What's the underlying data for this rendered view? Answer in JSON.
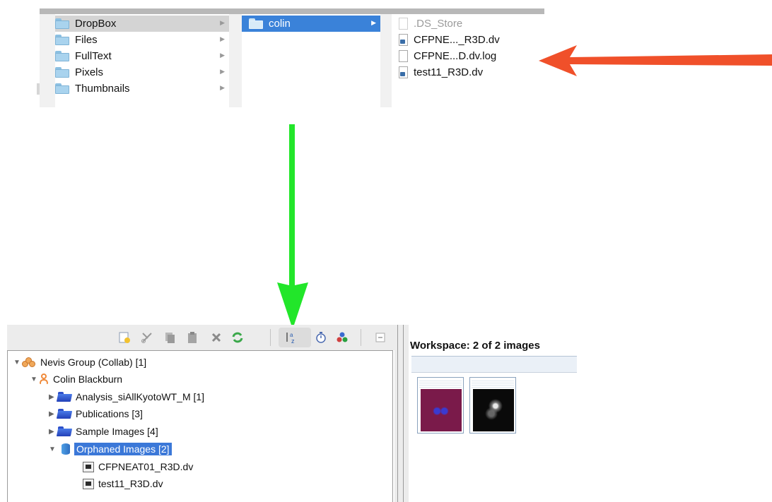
{
  "finder": {
    "column1": {
      "items": [
        {
          "label": "DropBox",
          "selected": true
        },
        {
          "label": "Files"
        },
        {
          "label": "FullText"
        },
        {
          "label": "Pixels"
        },
        {
          "label": "Thumbnails"
        }
      ]
    },
    "column2": {
      "items": [
        {
          "label": "colin",
          "selected": true
        }
      ]
    },
    "column3": {
      "items": [
        {
          "label": ".DS_Store",
          "icon": "blank-document-icon"
        },
        {
          "label": "CFPNE..._R3D.dv",
          "icon": "dv-document-icon"
        },
        {
          "label": "CFPNE...D.dv.log",
          "icon": "document-icon"
        },
        {
          "label": "test11_R3D.dv",
          "icon": "dv-document-icon"
        }
      ]
    }
  },
  "arrows": {
    "red": {
      "color": "#f0502a",
      "icon": "arrow-left"
    },
    "green": {
      "color": "#22e62a",
      "icon": "arrow-down"
    }
  },
  "toolbar": {
    "buttons": [
      "new-icon",
      "cut-icon",
      "copy-icon",
      "paste-icon",
      "delete-icon",
      "refresh-icon",
      "sort-alpha-icon",
      "sort-date-icon",
      "filter-icon",
      "collapse-icon"
    ],
    "active": "sort-alpha-icon"
  },
  "tree": {
    "group": "Nevis Group (Collab) [1]",
    "user": "Colin Blackburn",
    "projects": [
      "Analysis_siAllKyotoWT_M [1]",
      "Publications [3]",
      "Sample Images [4]"
    ],
    "orphaned": "Orphaned Images [2]",
    "images": [
      "CFPNEAT01_R3D.dv",
      "test11_R3D.dv"
    ]
  },
  "workspace": {
    "title": "Workspace: 2 of 2 images",
    "thumbnails": [
      {
        "name": "image-thumbnail-1",
        "color": "#7a1a4a"
      },
      {
        "name": "image-thumbnail-2",
        "color": "#0a0a0a"
      }
    ]
  }
}
